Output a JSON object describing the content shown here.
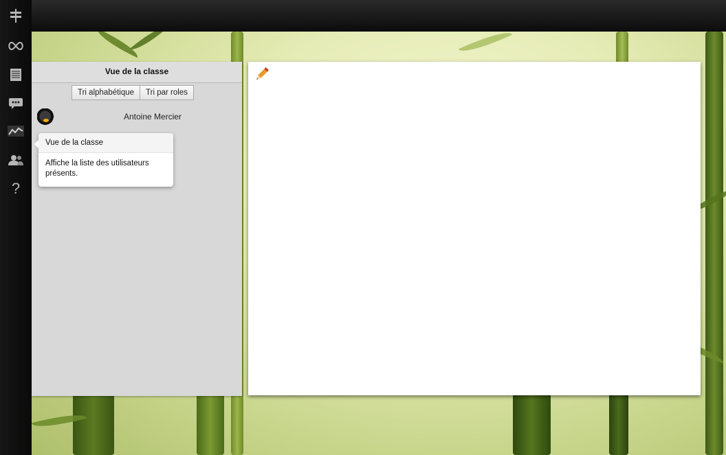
{
  "sidebar": {
    "icons": [
      "signpost-icon",
      "infinity-icon",
      "notepad-icon",
      "chat-icon",
      "chart-icon",
      "users-icon",
      "help-icon"
    ],
    "help_glyph": "?"
  },
  "panel": {
    "title": "Vue de la classe",
    "sort_alpha": "Tri alphabétique",
    "sort_roles": "Tri par roles",
    "user_name": "Antoine Mercier"
  },
  "tooltip": {
    "title": "Vue de la classe",
    "body": "Affiche la liste des utilisateurs présents."
  },
  "whiteboard": {
    "tool_icon": "pencil-icon"
  },
  "colors": {
    "sidebar": "#111111",
    "panel": "#d8d8d8",
    "background_green": "#c8d68c",
    "pencil": "#e89a2a"
  }
}
